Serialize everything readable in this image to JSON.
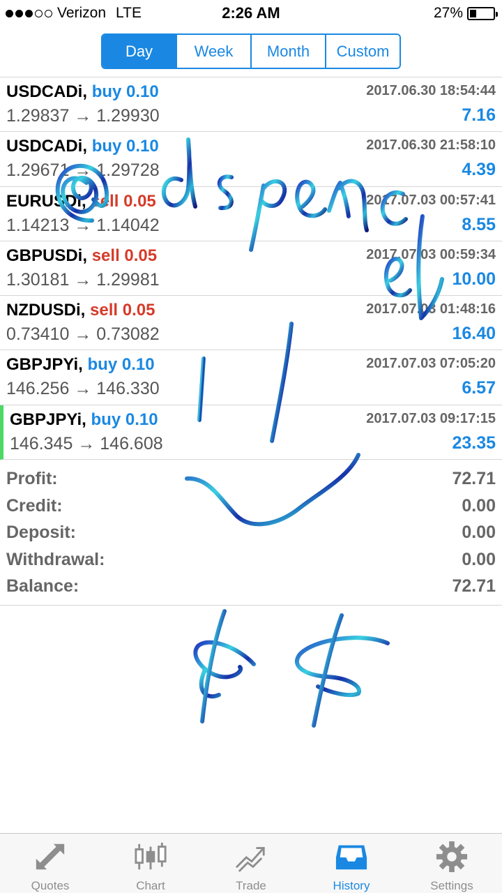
{
  "status_bar": {
    "carrier": "Verizon",
    "network": "LTE",
    "time": "2:26 AM",
    "battery": "27%",
    "battery_level": 0.27,
    "signal_bars": 3,
    "signal_total": 5
  },
  "period_tabs": [
    {
      "label": "Day",
      "active": true
    },
    {
      "label": "Week",
      "active": false
    },
    {
      "label": "Month",
      "active": false
    },
    {
      "label": "Custom",
      "active": false
    }
  ],
  "trades": [
    {
      "symbol": "USDCADi",
      "side": "buy",
      "volume": "0.10",
      "prices": "1.29837 → 1.29930",
      "time": "2017.06.30 18:54:44",
      "profit": "7.16"
    },
    {
      "symbol": "USDCADi",
      "side": "buy",
      "volume": "0.10",
      "prices": "1.29671 → 1.29728",
      "time": "2017.06.30 21:58:10",
      "profit": "4.39"
    },
    {
      "symbol": "EURUSDi",
      "side": "sell",
      "volume": "0.05",
      "prices": "1.14213 → 1.14042",
      "time": "2017.07.03 00:57:41",
      "profit": "8.55"
    },
    {
      "symbol": "GBPUSDi",
      "side": "sell",
      "volume": "0.05",
      "prices": "1.30181 → 1.29981",
      "time": "2017.07.03 00:59:34",
      "profit": "10.00"
    },
    {
      "symbol": "NZDUSDi",
      "side": "sell",
      "volume": "0.05",
      "prices": "0.73410 → 0.73082",
      "time": "2017.07.03 01:48:16",
      "profit": "16.40"
    },
    {
      "symbol": "GBPJPYi",
      "side": "buy",
      "volume": "0.10",
      "prices": "146.256 → 146.330",
      "time": "2017.07.03 07:05:20",
      "profit": "6.57"
    },
    {
      "symbol": "GBPJPYi",
      "side": "buy",
      "volume": "0.10",
      "prices": "146.345 → 146.608",
      "time": "2017.07.03 09:17:15",
      "profit": "23.35"
    }
  ],
  "summary": [
    {
      "label": "Profit:",
      "value": "72.71"
    },
    {
      "label": "Credit:",
      "value": "0.00"
    },
    {
      "label": "Deposit:",
      "value": "0.00"
    },
    {
      "label": "Withdrawal:",
      "value": "0.00"
    },
    {
      "label": "Balance:",
      "value": "72.71"
    }
  ],
  "tab_bar": [
    {
      "label": "Quotes",
      "icon": "quotes-arrows-icon",
      "active": false
    },
    {
      "label": "Chart",
      "icon": "candlestick-chart-icon",
      "active": false
    },
    {
      "label": "Trade",
      "icon": "trade-trend-icon",
      "active": false
    },
    {
      "label": "History",
      "icon": "history-tray-icon",
      "active": true
    },
    {
      "label": "Settings",
      "icon": "gear-icon",
      "active": false
    }
  ],
  "colors": {
    "accent": "#1a88e2",
    "sell": "#d63b2a",
    "selected_marker": "#4cd964",
    "scribble_blue": "#1f2fbf",
    "scribble_cyan": "#3ad0e0"
  }
}
